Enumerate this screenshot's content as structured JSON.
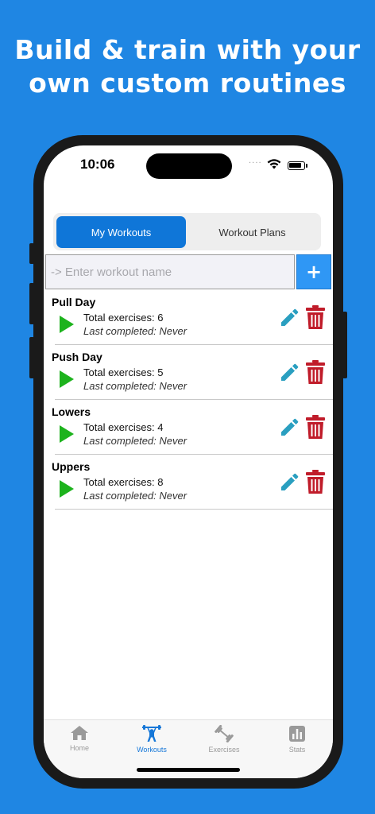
{
  "headline": {
    "line1": "Build & train with your",
    "line2": "own custom routines"
  },
  "status_bar": {
    "time": "10:06",
    "signal": "....",
    "icons": [
      "wifi-icon",
      "battery-icon"
    ]
  },
  "segmented_control": {
    "tabs": [
      {
        "label": "My Workouts",
        "selected": true
      },
      {
        "label": "Workout Plans",
        "selected": false
      }
    ]
  },
  "new_workout": {
    "placeholder": "-> Enter workout name",
    "add_label": "+"
  },
  "workouts": [
    {
      "name": "Pull Day",
      "exercises": "Total exercises: 6",
      "last": "Last completed: Never"
    },
    {
      "name": "Push Day",
      "exercises": "Total exercises: 5",
      "last": "Last completed: Never"
    },
    {
      "name": "Lowers",
      "exercises": "Total exercises: 4",
      "last": "Last completed: Never"
    },
    {
      "name": "Uppers",
      "exercises": "Total exercises: 8",
      "last": "Last completed: Never"
    }
  ],
  "tab_bar": {
    "items": [
      {
        "label": "Home",
        "icon": "home-icon",
        "active": false
      },
      {
        "label": "Workouts",
        "icon": "weightlifter-icon",
        "active": true
      },
      {
        "label": "Exercises",
        "icon": "dumbbell-icon",
        "active": false
      },
      {
        "label": "Stats",
        "icon": "bar-chart-icon",
        "active": false
      }
    ]
  },
  "colors": {
    "background": "#1f86e3",
    "accent": "#0f76d8",
    "play": "#1db31d",
    "edit": "#2a9fc0",
    "delete": "#c01c2a"
  }
}
